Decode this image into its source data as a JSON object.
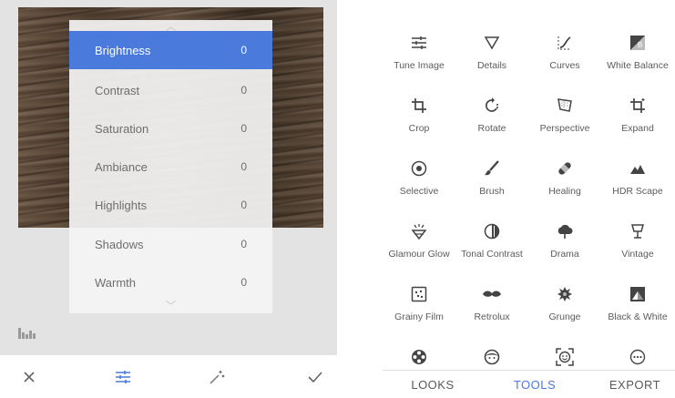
{
  "editor": {
    "adjustments": [
      {
        "label": "Brightness",
        "value": "0",
        "selected": true
      },
      {
        "label": "Contrast",
        "value": "0"
      },
      {
        "label": "Saturation",
        "value": "0"
      },
      {
        "label": "Ambiance",
        "value": "0"
      },
      {
        "label": "Highlights",
        "value": "0"
      },
      {
        "label": "Shadows",
        "value": "0"
      },
      {
        "label": "Warmth",
        "value": "0"
      }
    ],
    "bottom_icons": [
      "close-icon",
      "tune-sliders-icon",
      "auto-wand-icon",
      "apply-check-icon"
    ],
    "accent_color": "#4a7bdc"
  },
  "tools": {
    "items": [
      {
        "label": "Tune Image",
        "icon": "tune-image-icon"
      },
      {
        "label": "Details",
        "icon": "details-icon"
      },
      {
        "label": "Curves",
        "icon": "curves-icon"
      },
      {
        "label": "White Balance",
        "icon": "white-balance-icon"
      },
      {
        "label": "Crop",
        "icon": "crop-icon"
      },
      {
        "label": "Rotate",
        "icon": "rotate-icon"
      },
      {
        "label": "Perspective",
        "icon": "perspective-icon"
      },
      {
        "label": "Expand",
        "icon": "expand-icon"
      },
      {
        "label": "Selective",
        "icon": "selective-icon"
      },
      {
        "label": "Brush",
        "icon": "brush-icon"
      },
      {
        "label": "Healing",
        "icon": "healing-icon"
      },
      {
        "label": "HDR Scape",
        "icon": "hdr-scape-icon"
      },
      {
        "label": "Glamour Glow",
        "icon": "glamour-glow-icon"
      },
      {
        "label": "Tonal Contrast",
        "icon": "tonal-contrast-icon"
      },
      {
        "label": "Drama",
        "icon": "drama-icon"
      },
      {
        "label": "Vintage",
        "icon": "vintage-icon"
      },
      {
        "label": "Grainy Film",
        "icon": "grainy-film-icon"
      },
      {
        "label": "Retrolux",
        "icon": "retrolux-icon"
      },
      {
        "label": "Grunge",
        "icon": "grunge-icon"
      },
      {
        "label": "Black & White",
        "icon": "black-white-icon"
      },
      {
        "label": "",
        "icon": "film-reel-icon"
      },
      {
        "label": "",
        "icon": "face-icon"
      },
      {
        "label": "",
        "icon": "face-detect-icon"
      },
      {
        "label": "",
        "icon": "more-dots-icon"
      }
    ]
  },
  "tabs": [
    {
      "label": "LOOKS"
    },
    {
      "label": "TOOLS",
      "active": true
    },
    {
      "label": "EXPORT"
    }
  ]
}
